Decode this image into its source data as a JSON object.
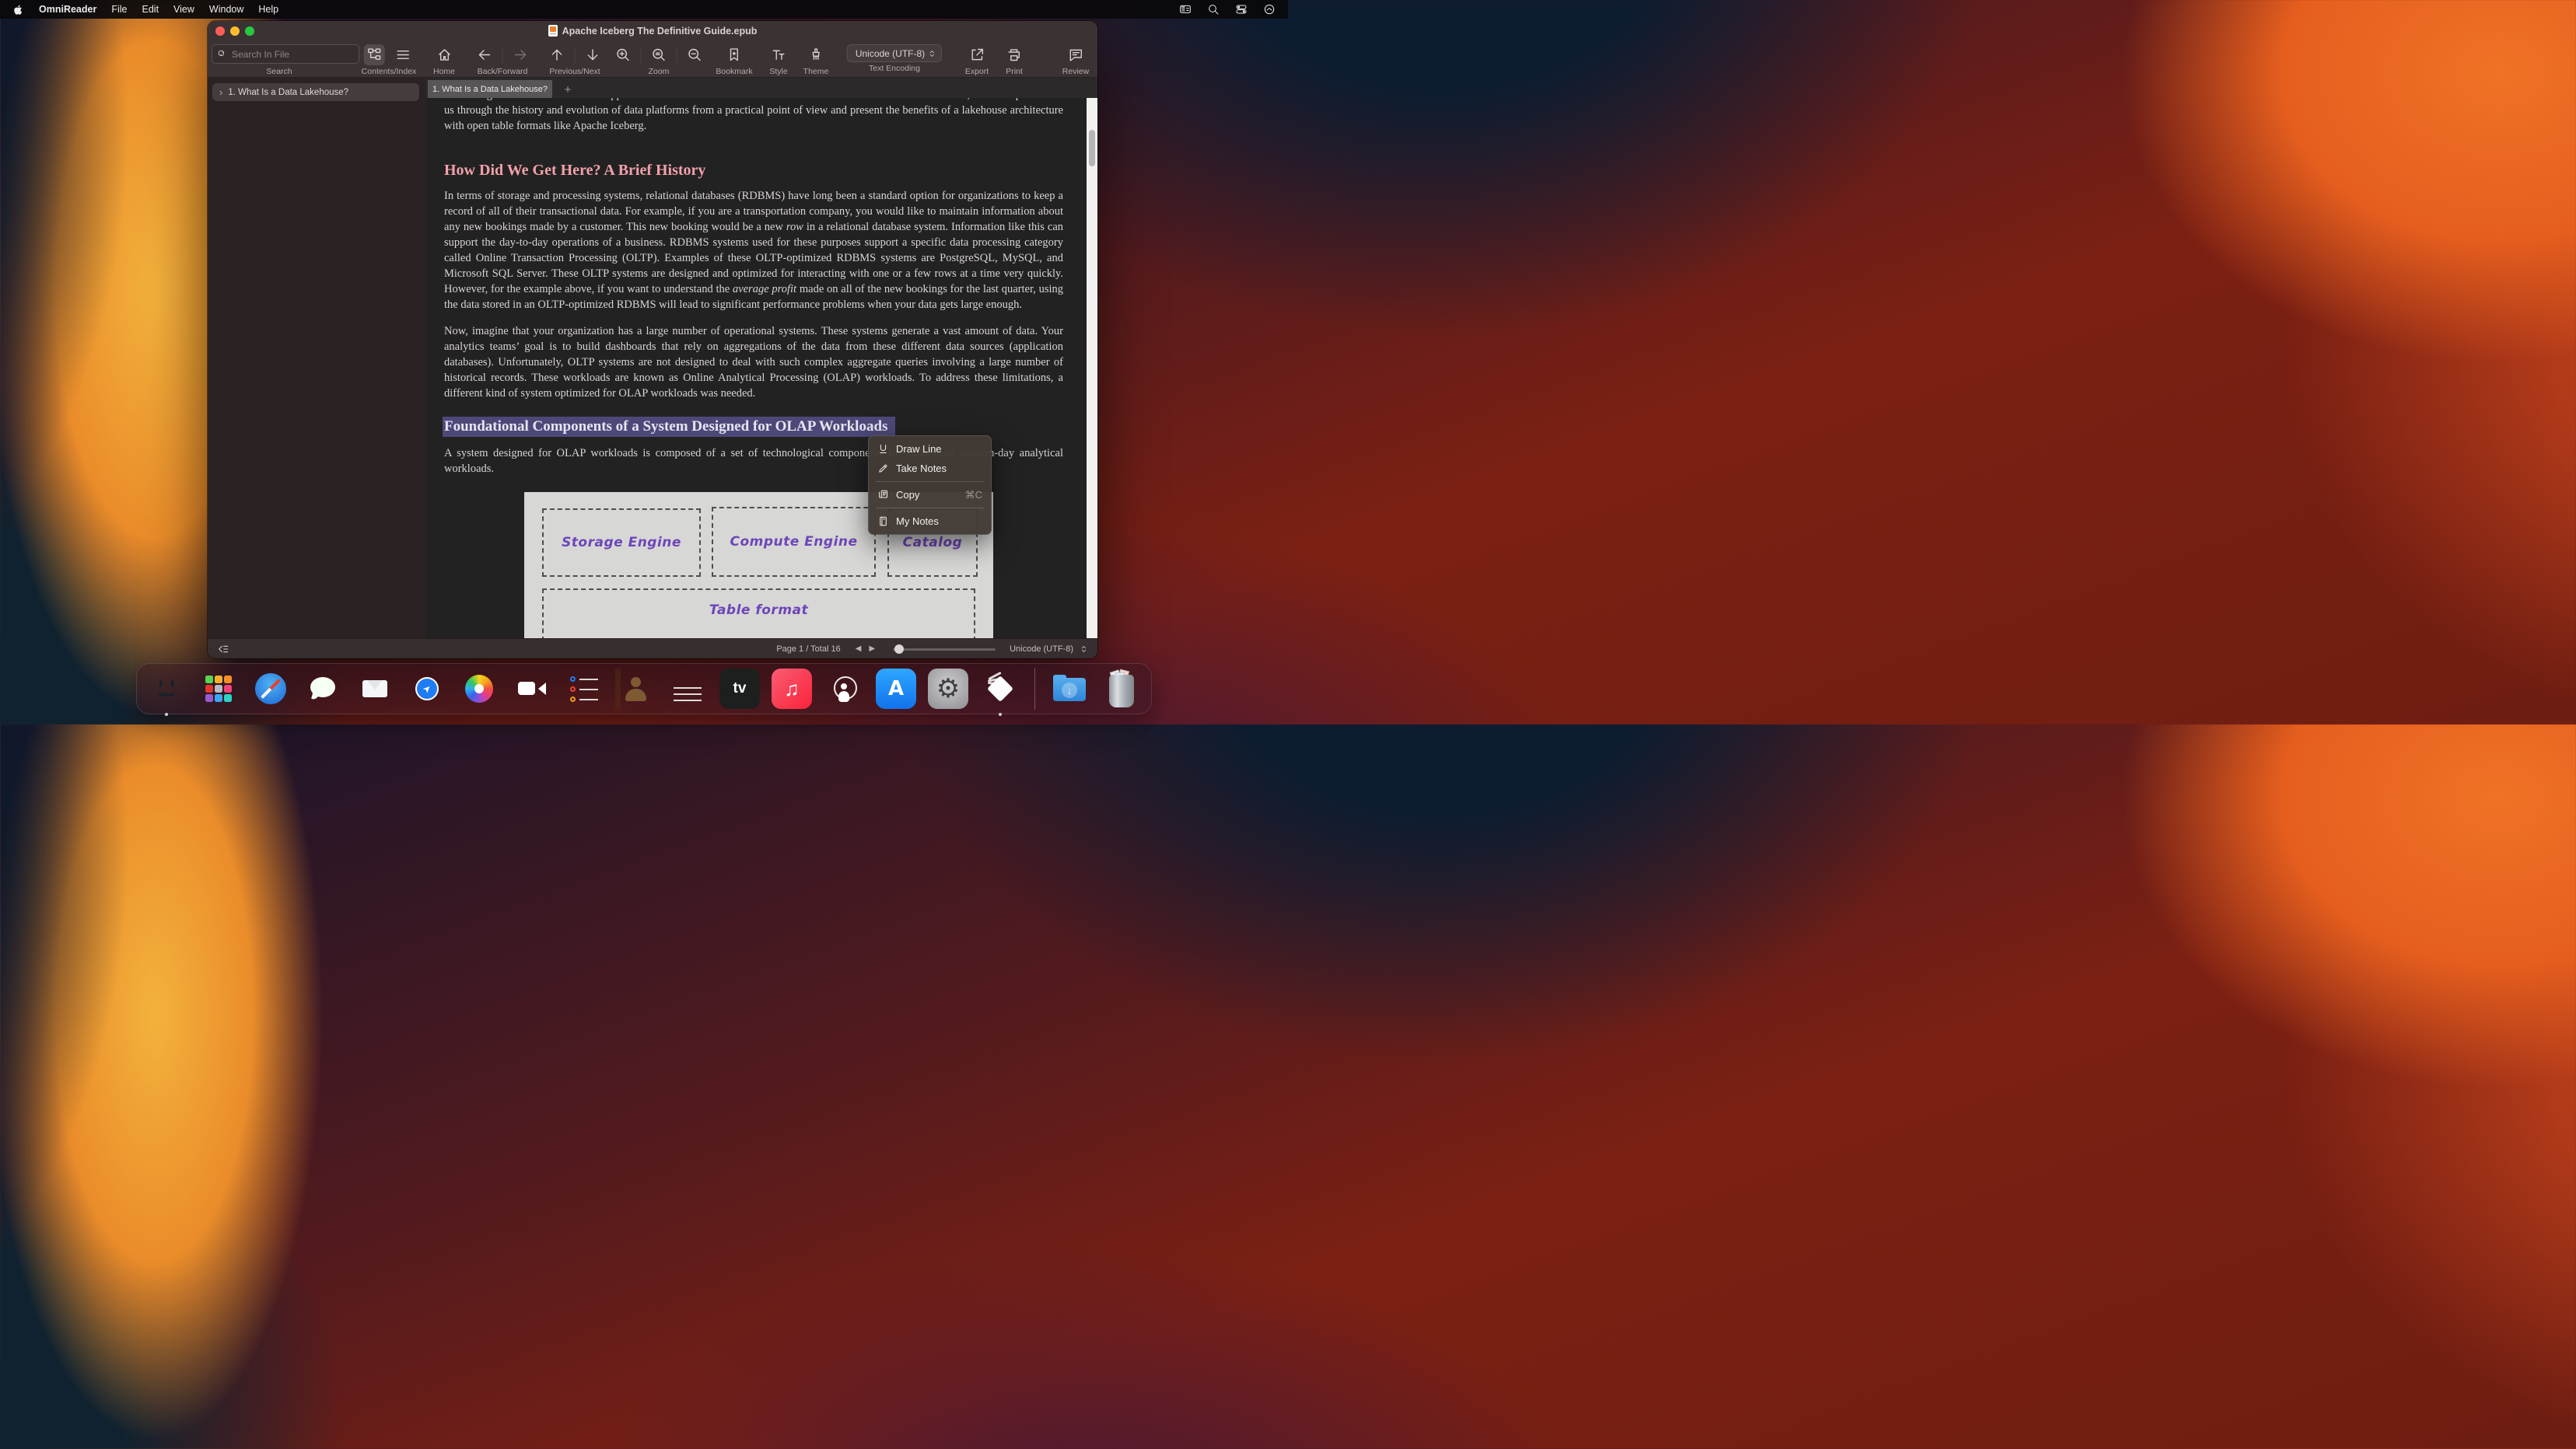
{
  "menu_bar": {
    "app_name": "OmniReader",
    "menus": [
      "File",
      "Edit",
      "View",
      "Window",
      "Help"
    ],
    "status_icons": [
      "window-switcher-icon",
      "search-icon",
      "control-center-icon",
      "clock-icon"
    ]
  },
  "window": {
    "title": "Apache Iceberg The Definitive Guide.epub",
    "toolbar": {
      "search_placeholder": "Search In File",
      "encoding_value": "Unicode  (UTF-8)",
      "groups": [
        {
          "label": "Search"
        },
        {
          "label": "Contents/Index"
        },
        {
          "label": "Home"
        },
        {
          "label": "Back/Forward"
        },
        {
          "label": "Previous/Next"
        },
        {
          "label": "Zoom"
        },
        {
          "label": "Bookmark"
        },
        {
          "label": "Style"
        },
        {
          "label": "Theme"
        },
        {
          "label": "Text Encoding"
        },
        {
          "label": "Export"
        },
        {
          "label": "Print"
        },
        {
          "label": "Review"
        }
      ]
    },
    "tab_bar": {
      "active_tab": "1. What Is a Data Lakehouse?",
      "add_label": "+"
    },
    "sidebar": {
      "chevron": "›",
      "items": [
        {
          "label": "1. What Is a Data Lakehouse?"
        }
      ]
    },
    "reader": {
      "clipped_line": "combining the benefits of both approaches. To understand how we arrived at the lakehouse architecture, this chapter takes",
      "paragraph_intro_tail": "us through the history and evolution of data platforms from a practical point of view and present the benefits of a lakehouse architecture with open table formats like Apache Iceberg.",
      "heading_history": "How Did We Get Here? A Brief History",
      "p2": {
        "a": "In terms of storage and processing systems, relational databases (RDBMS) have long been a standard option for organizations to keep a record of all of their transactional data. For example, if you are a transportation company, you would like to maintain information about any new bookings made by a customer. This new booking would be a new ",
        "i1": "row",
        "b": " in a relational database system. Information like this can support the day-to-day operations of a business. RDBMS systems used for these purposes support a specific data processing category called Online Transaction Processing (OLTP). Examples of these OLTP-optimized RDBMS systems are PostgreSQL, MySQL, and Microsoft SQL Server. These OLTP systems are designed and optimized for interacting with one or a few rows at a time very quickly. However, for the example above, if you want to understand the ",
        "i2": "average profit",
        "c": " made on all of the new bookings for the last quarter, using the data stored in an OLTP-optimized RDBMS will lead to significant performance problems when your data gets large enough."
      },
      "paragraph_olap": "Now, imagine that your organization has a large number of operational systems. These systems generate a vast amount of data. Your analytics teams’ goal is to build dashboards that rely on aggregations of the data from these different data sources (application databases). Unfortunately, OLTP systems are not designed to deal with such complex aggregate queries involving a large number of historical records. These workloads are known as Online Analytical Processing (OLAP) workloads. To address these limitations, a different kind of system optimized for OLAP workloads was needed.",
      "heading_foundational": "Foundational Components of a System Designed for OLAP Workloads",
      "paragraph_system": "A system designed for OLAP workloads is composed of a set of technological components for addressing modern-day analytical workloads.",
      "diagram": {
        "storage": "Storage Engine",
        "compute": "Compute Engine",
        "catalog": "Catalog",
        "table": "Table format"
      }
    },
    "context_menu": {
      "items": [
        {
          "label": "Draw Line",
          "icon": "underline-icon"
        },
        {
          "label": "Take Notes",
          "icon": "pencil-icon"
        },
        {
          "label": "Copy",
          "shortcut": "⌘C",
          "icon": "copy-icon"
        },
        {
          "label": "My Notes",
          "icon": "notebook-icon"
        }
      ]
    },
    "status_bar": {
      "page_info": "Page 1 / Total 16",
      "prev_glyph": "◀",
      "next_glyph": "▶",
      "encoding": "Unicode  (UTF-8)"
    }
  },
  "dock": {
    "items": [
      "finder",
      "launchpad",
      "safari",
      "messages",
      "mail",
      "maps",
      "photos",
      "facetime",
      "reminders",
      "contacts",
      "notes",
      "apple-tv",
      "music",
      "podcasts",
      "app-store",
      "system-settings",
      "omnireader",
      "downloads",
      "trash"
    ],
    "running": [
      "finder",
      "omnireader"
    ],
    "glyphs": {
      "tv": "tv",
      "music": "♫",
      "app_store": "A",
      "settings": "⚙",
      "downloads": "↓",
      "maps": "➤"
    }
  }
}
